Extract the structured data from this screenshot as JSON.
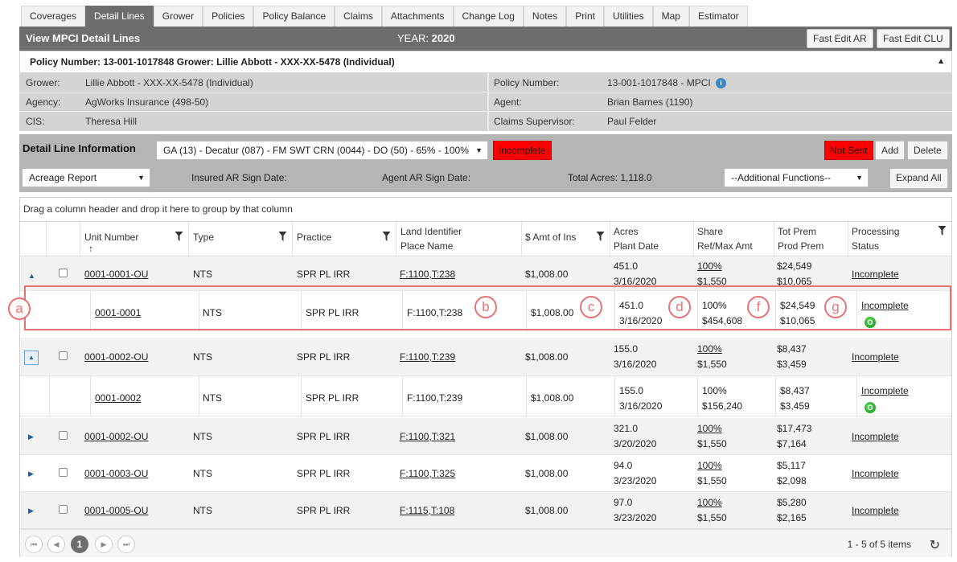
{
  "tabs": [
    "Coverages",
    "Detail Lines",
    "Grower",
    "Policies",
    "Policy Balance",
    "Claims",
    "Attachments",
    "Change Log",
    "Notes",
    "Print",
    "Utilities",
    "Map",
    "Estimator"
  ],
  "active_tab": "Detail Lines",
  "header": {
    "title": "View MPCI Detail Lines",
    "year_label": "YEAR:",
    "year_value": "2020",
    "fast_edit_ar": "Fast Edit AR",
    "fast_edit_clu": "Fast Edit CLU"
  },
  "policy_line": "Policy Number: 13-001-1017848 Grower: Lillie Abbott - XXX-XX-5478 (Individual)",
  "info": {
    "grower_label": "Grower:",
    "grower_value": "Lillie Abbott - XXX-XX-5478 (Individual)",
    "policy_label": "Policy Number:",
    "policy_value": "13-001-1017848 - MPCI",
    "agency_label": "Agency:",
    "agency_value": "AgWorks Insurance (498-50)",
    "agent_label": "Agent:",
    "agent_value": "Brian Barnes (1190)",
    "cis_label": "CIS:",
    "cis_value": "Theresa Hill",
    "claims_label": "Claims Supervisor:",
    "claims_value": "Paul Felder"
  },
  "detail_bar": {
    "label": "Detail Line Information",
    "selector": "GA (13) - Decatur (087) - FM SWT CRN (0044) - DO (50) - 65% - 100%",
    "status": "Incomplete",
    "sent_status": "Not Sent",
    "add": "Add",
    "delete": "Delete",
    "report_select": "Acreage Report",
    "insured_sign": "Insured AR Sign Date:",
    "agent_sign": "Agent AR Sign Date:",
    "total_acres": "Total Acres: 1,118.0",
    "additional": "--Additional Functions--",
    "expand_all": "Expand All"
  },
  "grid": {
    "group_hint": "Drag a column header and drop it here to group by that column",
    "columns": {
      "unit": "Unit Number",
      "type": "Type",
      "practice": "Practice",
      "land1": "Land Identifier",
      "land2": "Place Name",
      "amt": "$ Amt of Ins",
      "acres1": "Acres",
      "acres2": "Plant Date",
      "share1": "Share",
      "share2": "Ref/Max Amt",
      "prem1": "Tot Prem",
      "prem2": "Prod Prem",
      "proc1": "Processing",
      "proc2": "Status"
    },
    "rows": [
      {
        "unit": "0001-0001-OU",
        "type": "NTS",
        "practice": "SPR PL IRR",
        "land": "F:1100,T:238",
        "amt": "$1,008.00",
        "acres": "451.0",
        "date": "3/16/2020",
        "share": "100%",
        "ref": "$1,550",
        "tot": "$24,549",
        "prod": "$10,065",
        "status": "Incomplete"
      },
      {
        "unit": "0001-0001",
        "type": "NTS",
        "practice": "SPR PL IRR",
        "land": "F:1100,T:238",
        "amt": "$1,008.00",
        "acres": "451.0",
        "date": "3/16/2020",
        "share": "100%",
        "ref": "$454,608",
        "tot": "$24,549",
        "prod": "$10,065",
        "status": "Incomplete"
      },
      {
        "unit": "0001-0002-OU",
        "type": "NTS",
        "practice": "SPR PL IRR",
        "land": "F:1100,T:239",
        "amt": "$1,008.00",
        "acres": "155.0",
        "date": "3/16/2020",
        "share": "100%",
        "ref": "$1,550",
        "tot": "$8,437",
        "prod": "$3,459",
        "status": "Incomplete"
      },
      {
        "unit": "0001-0002",
        "type": "NTS",
        "practice": "SPR PL IRR",
        "land": "F:1100,T:239",
        "amt": "$1,008.00",
        "acres": "155.0",
        "date": "3/16/2020",
        "share": "100%",
        "ref": "$156,240",
        "tot": "$8,437",
        "prod": "$3,459",
        "status": "Incomplete"
      },
      {
        "unit": "0001-0002-OU",
        "type": "NTS",
        "practice": "SPR PL IRR",
        "land": "F:1100,T:321",
        "amt": "$1,008.00",
        "acres": "321.0",
        "date": "3/20/2020",
        "share": "100%",
        "ref": "$1,550",
        "tot": "$17,473",
        "prod": "$7,164",
        "status": "Incomplete"
      },
      {
        "unit": "0001-0003-OU",
        "type": "NTS",
        "practice": "SPR PL IRR",
        "land": "F:1100,T:325",
        "amt": "$1,008.00",
        "acres": "94.0",
        "date": "3/23/2020",
        "share": "100%",
        "ref": "$1,550",
        "tot": "$5,117",
        "prod": "$2,098",
        "status": "Incomplete"
      },
      {
        "unit": "0001-0005-OU",
        "type": "NTS",
        "practice": "SPR PL IRR",
        "land": "F:1115,T:108",
        "amt": "$1,008.00",
        "acres": "97.0",
        "date": "3/23/2020",
        "share": "100%",
        "ref": "$1,550",
        "tot": "$5,280",
        "prod": "$2,165",
        "status": "Incomplete"
      }
    ],
    "green_badge": "O",
    "pager_page": "1",
    "pager_info": "1 - 5 of 5 items"
  },
  "callouts": [
    "a",
    "b",
    "c",
    "d",
    "f",
    "g"
  ],
  "colors": {
    "header_gray": "#6d6d6d",
    "status_red": "#ff0000",
    "link_blue": "#1f5fa8",
    "callout_red": "#e57373"
  }
}
